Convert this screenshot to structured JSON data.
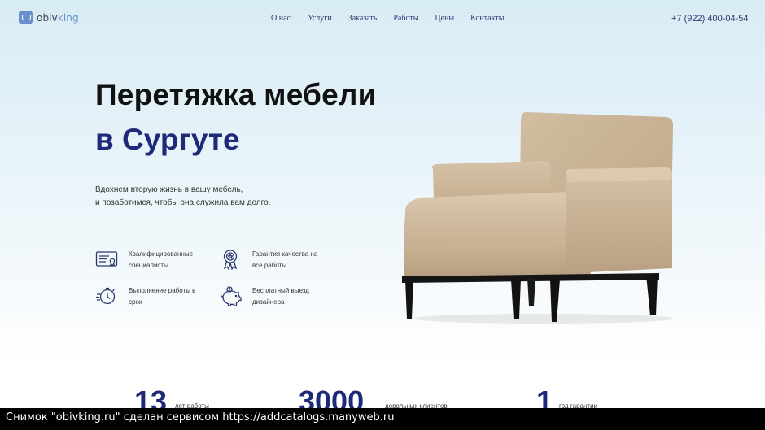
{
  "header": {
    "logo_prefix": "obiv",
    "logo_suffix": "king",
    "nav": [
      "О нас",
      "Услуги",
      "Заказать",
      "Работы",
      "Цены",
      "Контакты"
    ],
    "phone": "+7 (922) 400-04-54"
  },
  "hero": {
    "title_line1": "Перетяжка мебели",
    "title_line2": "в Сургуте",
    "lead_line1": "Вдохнем вторую жизнь в вашу мебель,",
    "lead_line2": "и позаботимся, чтобы она служила вам долго."
  },
  "features": [
    {
      "icon": "certificate-icon",
      "line1": "Квалифицированные",
      "line2": "специалисты"
    },
    {
      "icon": "award-badge-icon",
      "line1": "Гарантия качества на",
      "line2": "все работы"
    },
    {
      "icon": "stopwatch-icon",
      "line1": "Выполнение работы в",
      "line2": "срок"
    },
    {
      "icon": "piggy-bank-icon",
      "line1": "Бесплатный выезд",
      "line2": "дизайнера"
    }
  ],
  "stats": [
    {
      "value": "13",
      "label": "лет работы"
    },
    {
      "value": "3000",
      "label": "довольных клиентов"
    },
    {
      "value": "1",
      "label": "год гарантии"
    }
  ],
  "footer": {
    "caption": "Снимок \"obivking.ru\" сделан сервисом https://addcatalogs.manyweb.ru"
  },
  "colors": {
    "accent": "#1e2a78",
    "nav_text": "#2a3a70",
    "logo_blue": "#6b8fc9"
  }
}
